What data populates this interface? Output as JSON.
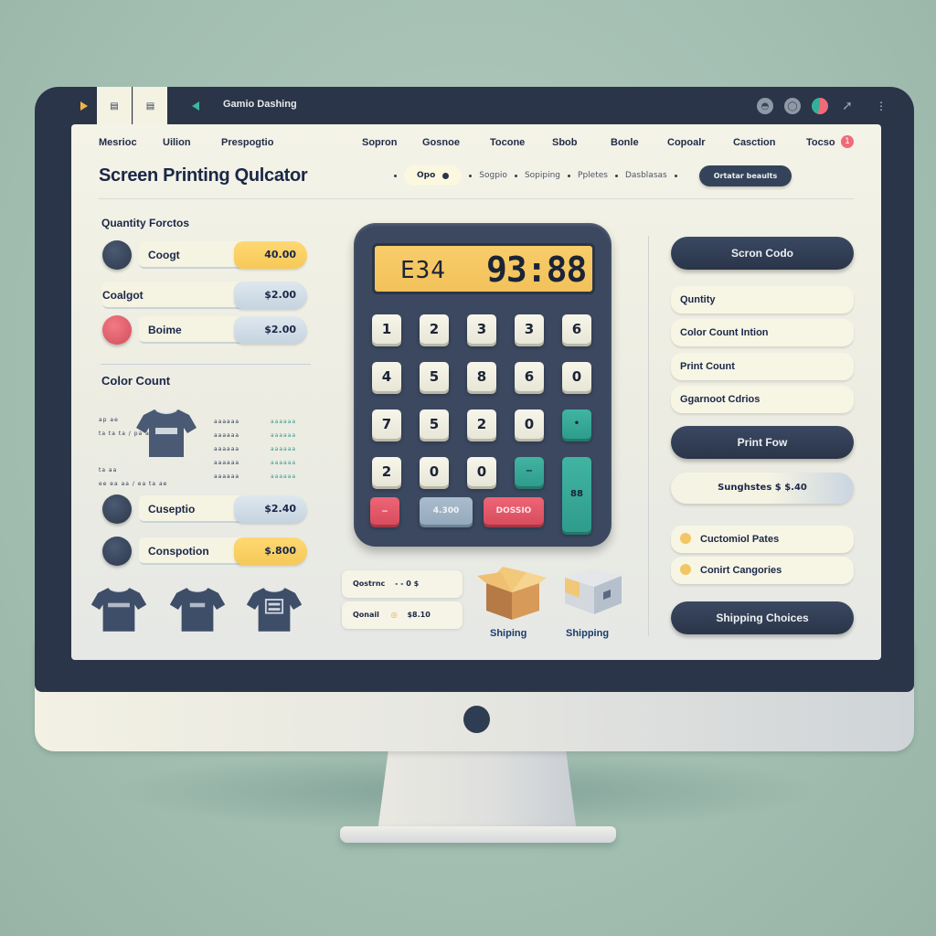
{
  "window": {
    "title": "Gamio Dashing",
    "tabs": [
      "tab-1",
      "tab-2"
    ]
  },
  "nav": {
    "items": [
      "Mesrioc",
      "Uilion",
      "Prespogtio",
      "Sopron",
      "Gosnoe",
      "Tocone",
      "Sbob",
      "Bonle",
      "Copoalr",
      "Casction",
      "Tocso"
    ],
    "badge": "1"
  },
  "page": {
    "title": "Screen Printing Qulcator"
  },
  "steps": {
    "active": "Opo",
    "items": [
      "Sogpio",
      "Sopiping",
      "Ppletes",
      "Dasblasas"
    ],
    "action_button": "Ortatar beaults"
  },
  "quantity_factors": {
    "heading": "Quantity Forctos",
    "rows": [
      {
        "name": "Coogt",
        "value": "40.00",
        "style": "yellow",
        "circle": "dark"
      },
      {
        "name": "Coalgot",
        "value": "$2.00",
        "style": "blue",
        "circle": "none"
      },
      {
        "name": "Boime",
        "value": "$2.00",
        "style": "blue",
        "circle": "red"
      }
    ]
  },
  "color_count": {
    "heading": "Color Count",
    "left_labels": [
      "ap ae",
      "ta ta ta / pa ap ae",
      "ta aa",
      "ee ea aa / ea ta ae"
    ],
    "mid_labels": [
      "aaaaaa",
      "aaaaaa",
      "aaaaaa",
      "aaaaaa",
      "aaaaaa"
    ],
    "right_labels": [
      "aaaaaa",
      "aaaaaa",
      "aaaaaa",
      "aaaaaa",
      "aaaaaa"
    ]
  },
  "options": {
    "rows": [
      {
        "name": "Cuseptio",
        "value": "$2.40",
        "style": "blue"
      },
      {
        "name": "Conspotion",
        "value": "$.800",
        "style": "yellow"
      }
    ]
  },
  "calculator": {
    "display_small": "E34",
    "display_big": "93:88",
    "keys": [
      [
        "1",
        "2",
        "3",
        "3",
        "6"
      ],
      [
        "4",
        "5",
        "8",
        "6",
        "0"
      ],
      [
        "7",
        "5",
        "2",
        "0",
        "•"
      ],
      [
        "2",
        "0",
        "0",
        "−",
        "88"
      ]
    ],
    "bottom_keys": [
      "−",
      "4.300",
      "DOSSIO"
    ]
  },
  "summary": {
    "rows": [
      {
        "label": "Qostrnc",
        "value": "- - 0 $"
      },
      {
        "label": "Qonail",
        "value": "$8.10"
      }
    ]
  },
  "shipping": {
    "items": [
      "Shiping",
      "Shipping"
    ]
  },
  "right_panel": {
    "primary_button": "Scron Codo",
    "fields": [
      "Quntity",
      "Color Count Intion",
      "Print Count",
      "Ggarnoot Cdrios"
    ],
    "print_button": "Print Fow",
    "total_pill": "Sunghstes $  $.40",
    "radio_options": [
      "Cuctomiol Pates",
      "Conirt Cangories"
    ],
    "shipping_button": "Shipping Choices"
  },
  "colors": {
    "bezel": "#2a3549",
    "accent_yellow": "#f6c957",
    "accent_teal": "#35a898",
    "accent_red": "#e45a6a",
    "background": "#a3bfb2"
  }
}
